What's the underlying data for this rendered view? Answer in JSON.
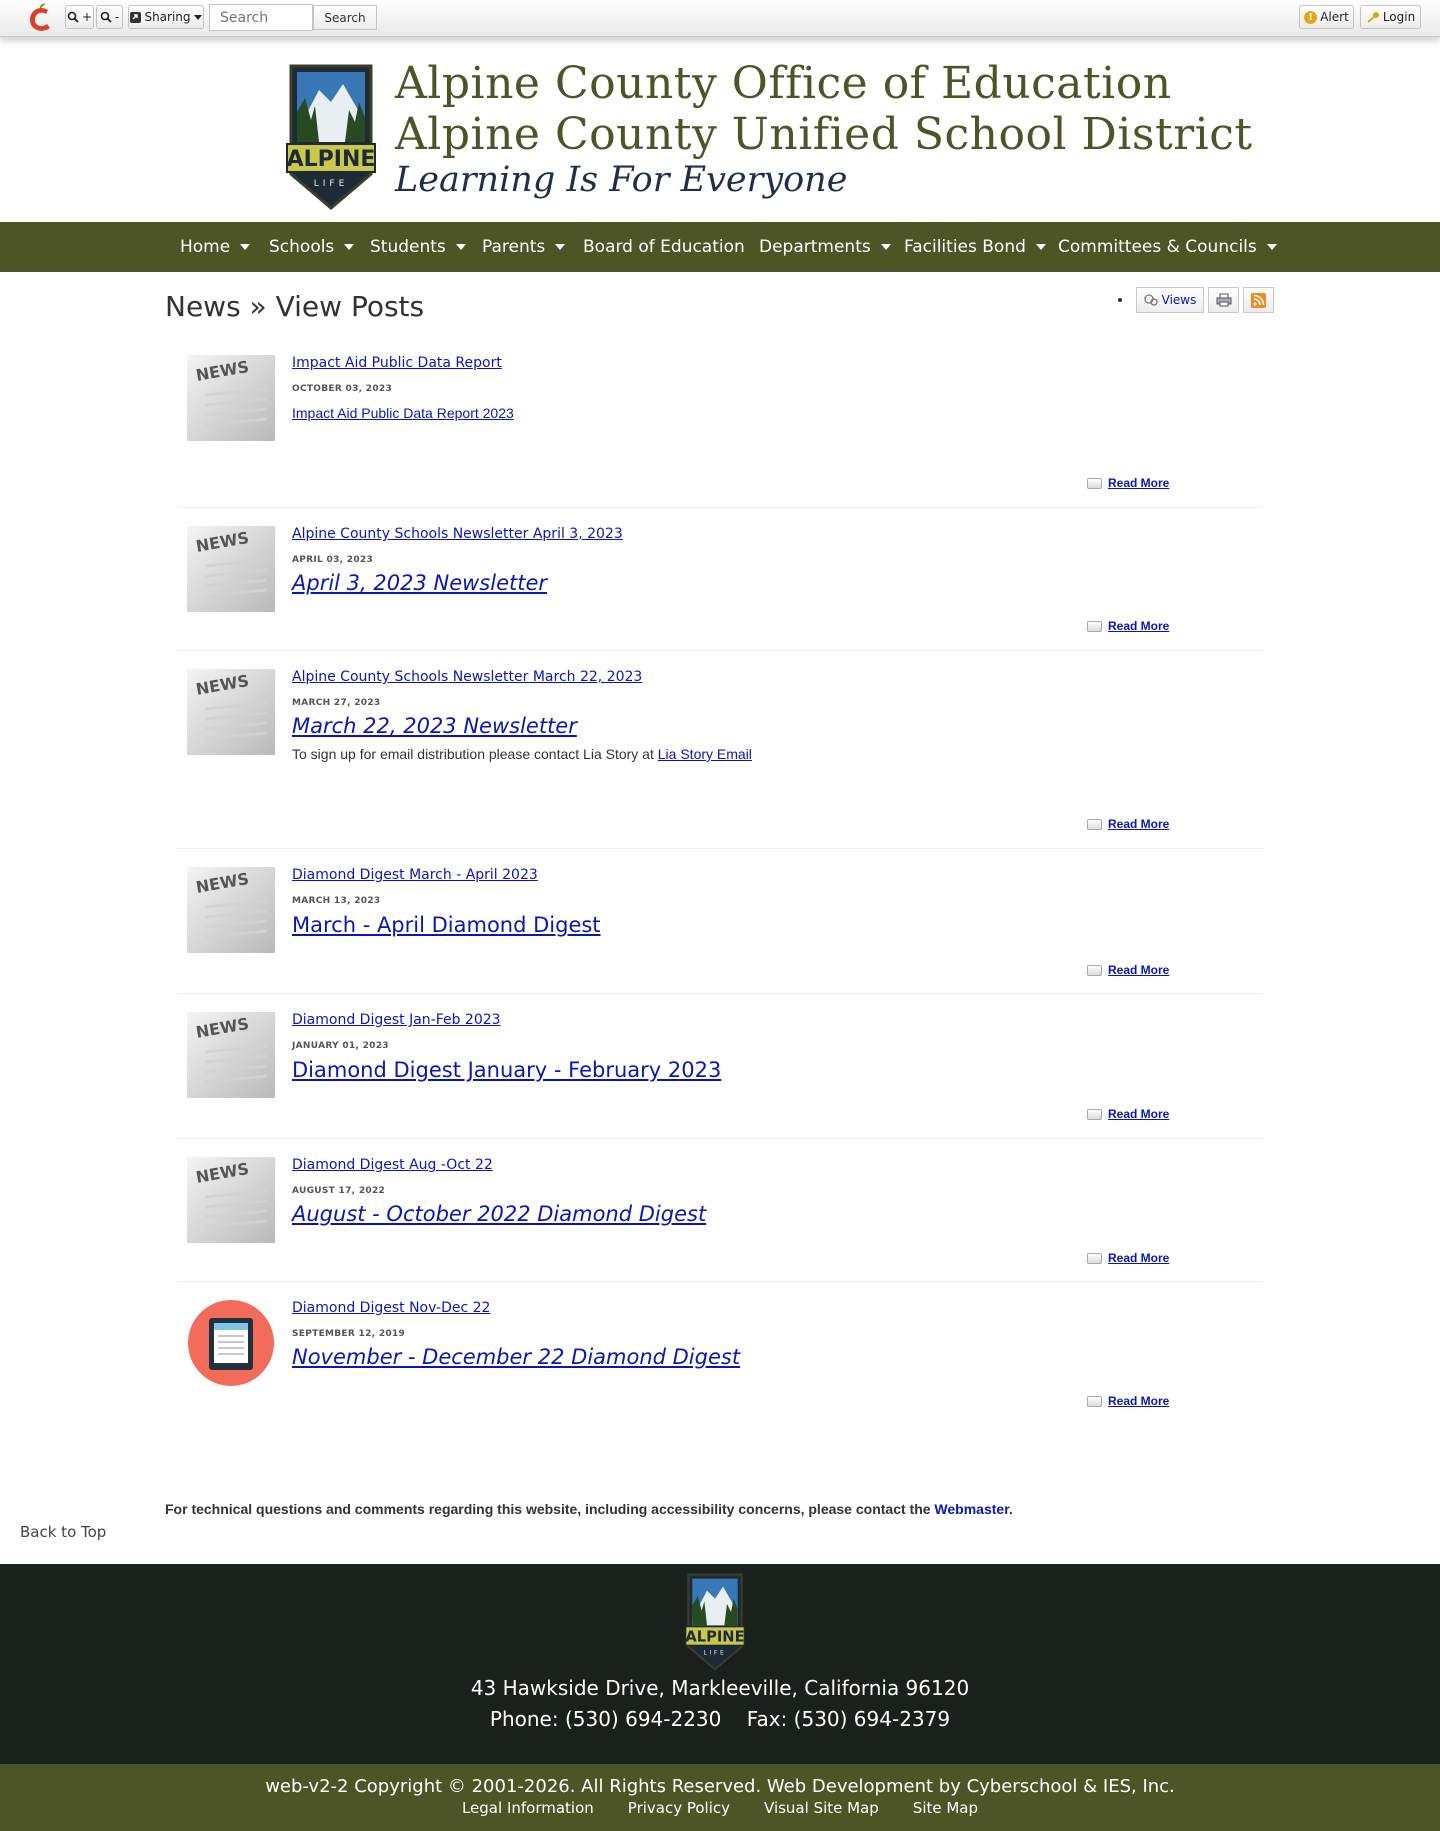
{
  "toolbar": {
    "zoom_in": "+",
    "zoom_out": "-",
    "sharing": "Sharing",
    "search_placeholder": "Search",
    "search_button": "Search",
    "alert": "Alert",
    "login": "Login"
  },
  "header": {
    "title_line1": "Alpine County Office of Education",
    "title_line2": "Alpine County Unified School District",
    "tagline": "Learning Is For Everyone",
    "logo_text": "ALPINE",
    "logo_subtext": "LIFE"
  },
  "nav": {
    "items": [
      {
        "label": "Home",
        "caret": true
      },
      {
        "label": "Schools",
        "caret": true
      },
      {
        "label": "Students",
        "caret": true
      },
      {
        "label": "Parents",
        "caret": true
      },
      {
        "label": "Board of Education",
        "caret": false
      },
      {
        "label": "Departments",
        "caret": true
      },
      {
        "label": "Facilities Bond",
        "caret": true
      },
      {
        "label": "Committees & Councils",
        "caret": true
      }
    ]
  },
  "page": {
    "title": "News » View Posts",
    "views_label": "Views"
  },
  "posts": [
    {
      "title": "Impact Aid Public Data Report",
      "date": "OCTOBER 03, 2023",
      "sub": "Impact Aid Public Data Report 2023",
      "read_more": "Read More"
    },
    {
      "title": "Alpine County Schools Newsletter April 3, 2023",
      "date": "APRIL 03, 2023",
      "big": "April 3, 2023 Newsletter",
      "read_more": "Read More"
    },
    {
      "title": "Alpine County Schools Newsletter March 22, 2023",
      "date": "MARCH 27, 2023",
      "big": "March 22, 2023 Newsletter",
      "text": "To sign up for email distribution please contact Lia Story at",
      "text_link": "Lia Story Email",
      "read_more": "Read More"
    },
    {
      "title": "Diamond Digest March - April 2023",
      "date": "MARCH 13, 2023",
      "big": "March - April Diamond Digest ",
      "read_more": "Read More"
    },
    {
      "title": "Diamond Digest Jan-Feb 2023",
      "date": "JANUARY 01, 2023",
      "big": "Diamond Digest January - February 2023",
      "read_more": "Read More"
    },
    {
      "title": "Diamond Digest Aug -Oct 22",
      "date": "AUGUST 17, 2022",
      "big": "August - October 2022 Diamond Digest",
      "read_more": "Read More"
    },
    {
      "title": "Diamond Digest Nov-Dec 22",
      "date": "SEPTEMBER 12, 2019",
      "big": "November - December 22 Diamond Digest",
      "read_more": "Read More"
    }
  ],
  "news_icon_text": "NEWS",
  "contact": {
    "text": "For technical questions and comments regarding this website, including accessibility concerns, please contact the",
    "link": "Webmaster",
    "end": "."
  },
  "back_to_top": "Back to Top",
  "footer": {
    "address": "43 Hawkside Drive, Markleeville, California 96120",
    "phone": "Phone: (530) 694-2230    Fax: (530) 694-2379",
    "copyright": "web-v2-2 Copyright © 2001-2026. All Rights Reserved. Web Development by Cyberschool & IES, Inc.",
    "links": [
      "Legal Information",
      "Privacy Policy",
      "Visual Site Map",
      "Site Map"
    ]
  },
  "colors": {
    "brand_olive": "#4d5527",
    "footer_dark": "#1a211b",
    "link_blue": "#0a17b6"
  }
}
